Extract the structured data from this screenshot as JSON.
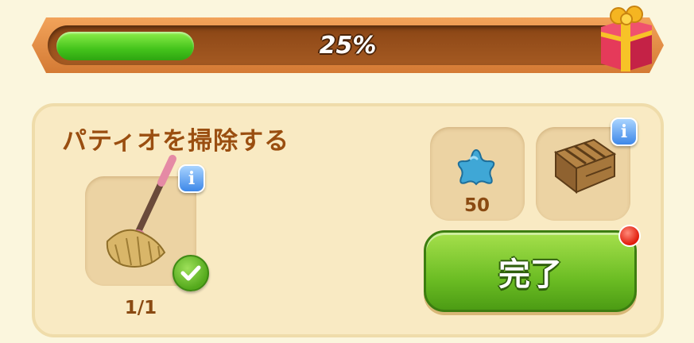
{
  "progress": {
    "label": "25%",
    "value": 0.25
  },
  "quest": {
    "title": "パティオを掃除する"
  },
  "requirement": {
    "item_icon": "mop-icon",
    "count": "1/1",
    "status_icon": "checkmark-icon"
  },
  "rewards": [
    {
      "icon": "blue-star-icon",
      "count": "50"
    },
    {
      "icon": "wooden-crate-icon",
      "count": ""
    }
  ],
  "complete_button": {
    "label": "完了"
  },
  "colors": {
    "accent_green": "#6cbd24",
    "title_brown": "#9a4e10",
    "notify_red": "#e01a0a"
  }
}
